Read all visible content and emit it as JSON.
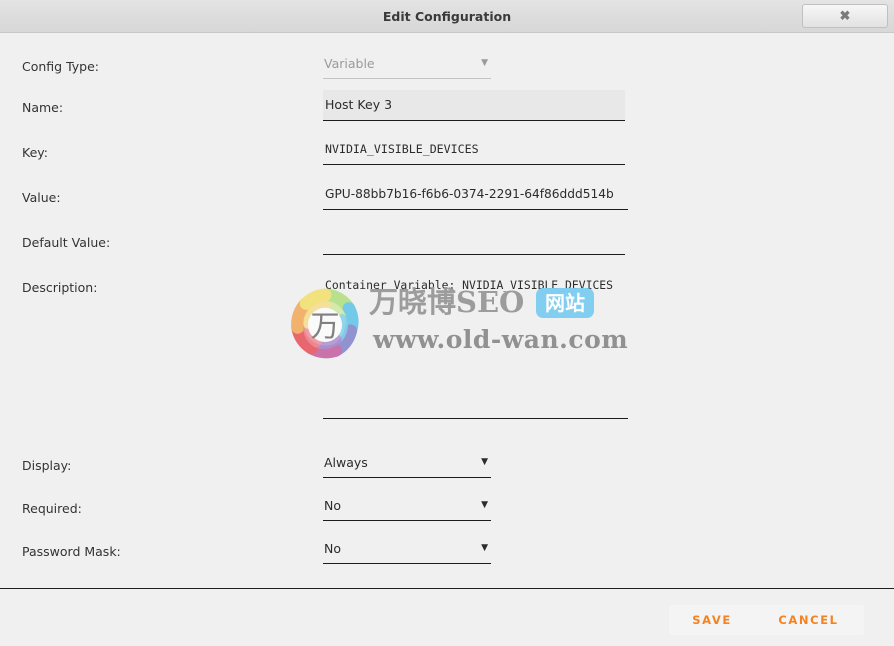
{
  "window": {
    "title": "Edit Configuration",
    "close_label": "✖"
  },
  "form": {
    "fields": [
      {
        "label": "Config Type:",
        "value": "Variable",
        "kind": "select",
        "disabled": true,
        "arrow": "▼"
      },
      {
        "label": "Name:",
        "value": "Host Key 3",
        "kind": "text",
        "filled": true
      },
      {
        "label": "Key:",
        "value": "NVIDIA_VISIBLE_DEVICES",
        "kind": "text",
        "filled": false
      },
      {
        "label": "Value:",
        "value": "GPU-88bb7b16-f6b6-0374-2291-64f86ddd514b",
        "kind": "text",
        "filled": false
      },
      {
        "label": "Default Value:",
        "value": "",
        "kind": "text",
        "filled": false
      },
      {
        "label": "Description:",
        "value": "Container Variable: NVIDIA_VISIBLE_DEVICES",
        "kind": "textarea"
      },
      {
        "label": "Display:",
        "value": "Always",
        "kind": "select",
        "disabled": false,
        "arrow": "▼"
      },
      {
        "label": "Required:",
        "value": "No",
        "kind": "select",
        "disabled": false,
        "arrow": "▼"
      },
      {
        "label": "Password Mask:",
        "value": "No",
        "kind": "select",
        "disabled": false,
        "arrow": "▼"
      }
    ]
  },
  "footer": {
    "save_label": "SAVE",
    "cancel_label": "CANCEL"
  },
  "watermark": {
    "logo_char": "万",
    "brand": "万晓博SEO",
    "badge": "网站",
    "url": "www.old-wan.com"
  },
  "colors": {
    "background": "#f0f0f0",
    "titlebar": "#dcdcdc",
    "field_underline": "#1c1c1c",
    "field_filled": "#e8e8e8",
    "disabled_text": "#9a9a9a",
    "button_text": "#f5821f",
    "button_border_start": "#e8342a",
    "button_border_end": "#f7941e",
    "badge_blue": "#7ecdf2"
  }
}
